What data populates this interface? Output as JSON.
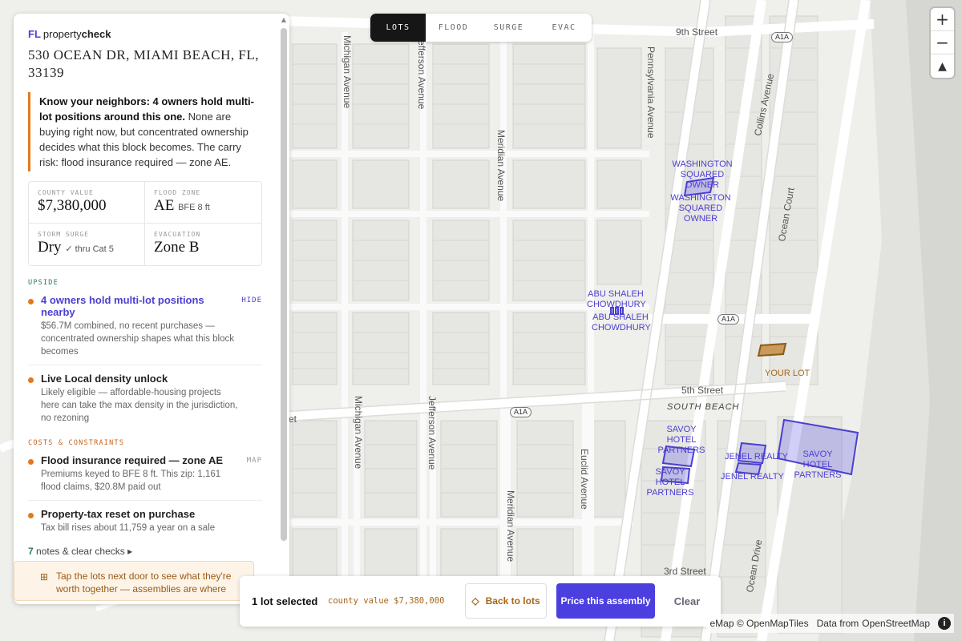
{
  "layer_tabs": [
    "LOTS",
    "FLOOD",
    "SURGE",
    "EVAC"
  ],
  "active_tab": "LOTS",
  "zoom": {
    "in": "+",
    "out": "−",
    "compass": "▲"
  },
  "panel": {
    "brand_mark": "FL",
    "brand_name": "property",
    "brand_bold": "check",
    "address": "530 OCEAN DR, MIAMI BEACH, FL, 33139",
    "callout_bold": "Know your neighbors: 4 owners hold multi-lot positions around this one.",
    "callout_text": " None are buying right now, but concentrated ownership decides what this block becomes. The carry risk: flood insurance required — zone AE.",
    "stats": [
      {
        "label": "COUNTY VALUE",
        "value": "$7,380,000",
        "sub": ""
      },
      {
        "label": "FLOOD ZONE",
        "value": "AE",
        "sub": "BFE 8 ft"
      },
      {
        "label": "STORM SURGE",
        "value": "Dry",
        "sub": "✓ thru Cat 5"
      },
      {
        "label": "EVACUATION",
        "value": "Zone B",
        "sub": ""
      }
    ],
    "upside_heading": "UPSIDE",
    "upside": [
      {
        "title": "4 owners hold multi-lot positions nearby",
        "desc": "$56.7M combined, no recent purchases — concentrated ownership shapes what this block becomes",
        "action": "HIDE"
      },
      {
        "title": "Live Local density unlock",
        "desc": "Likely eligible — affordable-housing projects here can take the max density in the jurisdiction, no rezoning",
        "action": ""
      }
    ],
    "costs_heading": "COSTS & CONSTRAINTS",
    "costs": [
      {
        "title": "Flood insurance required — zone AE",
        "desc": "Premiums keyed to BFE 8 ft. This zip: 1,161 flood claims, $20.8M paid out",
        "action": "MAP"
      },
      {
        "title": "Property-tax reset on purchase",
        "desc": "Tax bill rises about 11,759 a year on a sale",
        "action": ""
      }
    ],
    "notes_count": "7",
    "notes_text": " notes & clear checks ▸",
    "tip_icon": "⊞",
    "tip_text": "Tap the lots next door to see what they're worth together — assemblies are where"
  },
  "bottom_bar": {
    "selected": "1 lot selected",
    "value": "county value $7,380,000",
    "back_icon": "◇",
    "back": "Back to lots",
    "price": "Price this assembly",
    "clear": "Clear"
  },
  "attribution": {
    "text1": "eMap © OpenMapTiles",
    "text2": "Data from",
    "text3": "OpenStreetMap",
    "info": "i"
  },
  "map": {
    "streets_vertical": [
      "Michigan Avenue",
      "Jefferson Avenue",
      "Meridian Avenue",
      "Pennsylvania Avenue",
      "Michigan Avenue",
      "Jefferson Avenue",
      "Meridian Avenue",
      "Euclid Avenue",
      "Collins Avenue",
      "Ocean Court",
      "Ocean Drive"
    ],
    "streets_horizontal": [
      "9th Street",
      "5th Street",
      "3rd Street",
      "et"
    ],
    "shields": [
      "A1A",
      "A1A",
      "A1A"
    ],
    "area_label": "SOUTH BEACH",
    "your_lot": "YOUR LOT",
    "owners": [
      "WASHINGTON SQUARED OWNER",
      "WASHINGTON SQUARED OWNER",
      "ABU SHALEH CHOWDHURY",
      "ABU SHALEH CHOWDHURY",
      "SAVOY HOTEL PARTNERS",
      "SAVOY HOTEL PARTNERS",
      "SAVOY HOTEL PARTNERS",
      "JENEL REALTY",
      "JENEL REALTY"
    ]
  }
}
